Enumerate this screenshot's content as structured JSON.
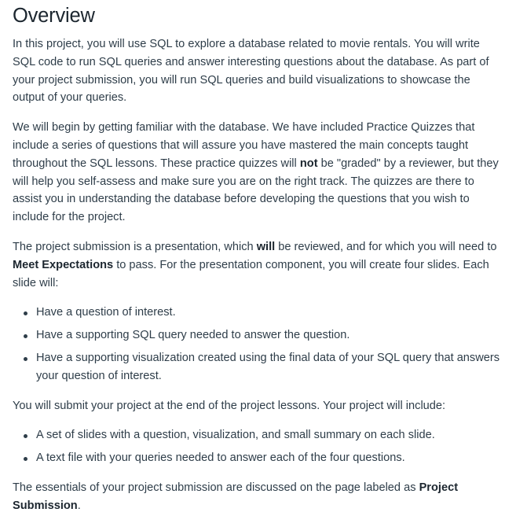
{
  "title": "Overview",
  "p1": "In this project, you will use SQL to explore a database related to movie rentals. You will write SQL code to run SQL queries and answer interesting questions about the database. As part of your project submission, you will run SQL queries and build visualizations to showcase the output of your queries.",
  "p2": {
    "before": "We will begin by getting familiar with the database. We have included Practice Quizzes that include a series of questions that will assure you have mastered the main concepts taught throughout the SQL lessons. These practice quizzes will ",
    "bold": "not",
    "after": " be \"graded\" by a reviewer, but they will help you self-assess and make sure you are on the right track. The quizzes are there to assist you in understanding the database before developing the questions that you wish to include for the project."
  },
  "p3": {
    "before": "The project submission is a presentation, which ",
    "bold1": "will",
    "middle": " be reviewed, and for which you will need to ",
    "bold2": "Meet Expectations",
    "after": " to pass. For the presentation component, you will create four slides. Each slide will:"
  },
  "list1": [
    "Have a question of interest.",
    "Have a supporting SQL query needed to answer the question.",
    "Have a supporting visualization created using the final data of your SQL query that answers your question of interest."
  ],
  "p4": "You will submit your project at the end of the project lessons. Your project will include:",
  "list2": [
    "A set of slides with a question, visualization, and small summary on each slide.",
    "A text file with your queries needed to answer each of the four questions."
  ],
  "p5": {
    "before": "The essentials of your project submission are discussed on the page labeled as ",
    "bold": "Project Submission",
    "after": "."
  }
}
